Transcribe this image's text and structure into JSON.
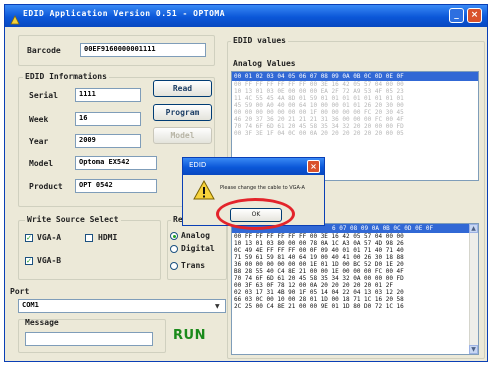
{
  "window": {
    "title": "EDID Application Version 0.51 - OPTOMA"
  },
  "barcode": {
    "label": "Barcode",
    "value": "00EF9160000001111"
  },
  "info": {
    "group_title": "EDID Informations",
    "serial_label": "Serial",
    "serial_value": "1111",
    "week_label": "Week",
    "week_value": "16",
    "year_label": "Year",
    "year_value": "2009",
    "model_label": "Model",
    "model_value": "Optoma EX542",
    "product_label": "Product",
    "product_value": "OPT 0542"
  },
  "buttons": {
    "read": "Read",
    "program": "Program",
    "model": "Model",
    "run": "RUN"
  },
  "write_source": {
    "title": "Write Source Select",
    "vga_a": "VGA-A",
    "hdmi": "HDMI",
    "vga_b": "VGA-B"
  },
  "modes": {
    "title": "Re",
    "analog": "Analog",
    "digital": "Digital",
    "trans": "Trans"
  },
  "port": {
    "label": "Port",
    "value": "COM1"
  },
  "message": {
    "label": "Message",
    "value": ""
  },
  "edid": {
    "group_title": "EDID values",
    "analog_title": "Analog Values",
    "header": "00 01 02 03 04 05 06 07 08 09 0A 0B 0C 0D 0E 0F",
    "header_partial": "6 07 08 09 0A 0B 0C 0D 0E 0F",
    "top_rows": [
      "00 FF FF FF FF FF FF 00 3E 16 42 05 57 04 00 00",
      "10 13 01 03 0E 00 00 00 EA 2F 72 A9 53 4F 05 23",
      "11 4C 55 45 4A 8D 01 59 01 01 01 01 01 01 01 01",
      "45 59 00 A0 40 00 64 10 00 00 01 01 26 20 30 00",
      "00 00 00 00 00 00 00 1F 00 00 00 00 FC 20 30 45",
      "46 20 37 36 20 21 21 21 31 36 00 00 00 FC 00 4F",
      "70 74 6F 6D 61 20 45 58 35 34 32 20 20 00 00 FD",
      "00 3F 3E 1F 04 0C 00 0A 20 20 20 20 20 20 00 05"
    ],
    "bottom_rows": [
      "00 FF FF FF FF FF FF 00 3E 16 42 05 57 04 00 00",
      "10 13 01 03 80 00 00 78 0A 1C A3 0A 57 4D 98 26",
      "0C 49 4E FF FF FF 00 0F 09 40 01 01 71 40 71 40",
      "71 59 61 59 81 40 64 19 00 40 41 00 26 30 18 88",
      "36 00 00 00 00 00 00 1E 01 1D 00 BC 52 D0 1E 20",
      "B8 28 55 40 C4 8E 21 00 00 1E 00 00 00 FC 00 4F",
      "70 74 6F 6D 61 20 45 58 35 34 32 0A 00 00 00 FD",
      "00 3F 63 0F 78 12 00 0A 20 20 20 20 20 01 2F",
      "02 03 17 31 4B 90 1F 05 14 04 22 04 13 03 12 20",
      "66 03 0C 00 10 00 28 01 1D 00 18 71 1C 16 20 58",
      "2C 25 00 C4 8E 21 00 00 9E 01 1D 80 D0 72 1C 16"
    ]
  },
  "dialog": {
    "title": "EDID",
    "message": "Please change the cable to VGA-A",
    "ok": "OK"
  }
}
